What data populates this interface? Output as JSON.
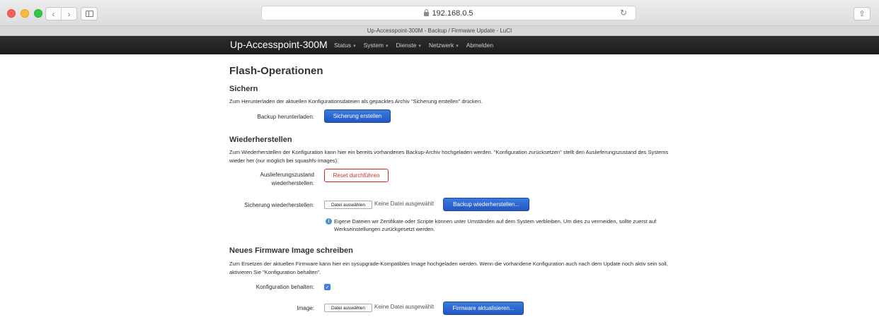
{
  "browser": {
    "url": "192.168.0.5",
    "tab_title": "Up-Accesspoint-300M - Backup / Firmware Update - LuCI"
  },
  "header": {
    "brand": "Up-Accesspoint-300M",
    "menu": [
      {
        "label": "Status",
        "has_caret": true
      },
      {
        "label": "System",
        "has_caret": true
      },
      {
        "label": "Dienste",
        "has_caret": true
      },
      {
        "label": "Netzwerk",
        "has_caret": true
      },
      {
        "label": "Abmelden",
        "has_caret": false
      }
    ],
    "caret": "▾"
  },
  "page": {
    "title": "Flash-Operationen",
    "backup": {
      "heading": "Sichern",
      "description": "Zum Herunterladen der aktuellen Konfigurationsdateien als gepacktes Archiv \"Sicherung erstellen\" drücken.",
      "label": "Backup herunterladen:",
      "button": "Sicherung erstellen"
    },
    "restore": {
      "heading": "Wiederherstellen",
      "description": "Zum Wiederherstellen der Konfiguration kann hier ein bereits vorhandenes Backup-Archiv hochgeladen werden. \"Konfiguration zurücksetzen\" stellt den Auslieferungszustand des Systems wieder her (nur möglich bei squashfs-Images).",
      "reset_label_1": "Auslieferungszustand",
      "reset_label_2": "wiederherstellen:",
      "reset_button": "Reset durchführen",
      "restore_label": "Sicherung wiederherstellen:",
      "file_button": "Datei auswählen",
      "file_none": "Keine Datei ausgewählt",
      "restore_button": "Backup wiederherstellen...",
      "note": "Eigene Dateien wir Zertifikate oder Scripte können unter Umständen auf dem System verbleiben. Um dies zu vermeiden, sollte zuerst auf Werkseinstellungen zurückgesetzt werden."
    },
    "firmware": {
      "heading": "Neues Firmware Image schreiben",
      "description": "Zum Ersetzen der aktuellen Firmware kann hier ein sysupgrade-Kompatibles Image hochgeladen werden. Wenn die vorhandene Konfiguration auch nach dem Update noch aktiv sein soll, aktivieren Sie \"Konfiguration behalten\".",
      "keep_label": "Konfiguration behalten:",
      "keep_checked": true,
      "image_label": "Image:",
      "file_button": "Datei auswählen",
      "file_none": "Keine Datei ausgewählt",
      "flash_button": "Firmware aktualisieren..."
    }
  }
}
